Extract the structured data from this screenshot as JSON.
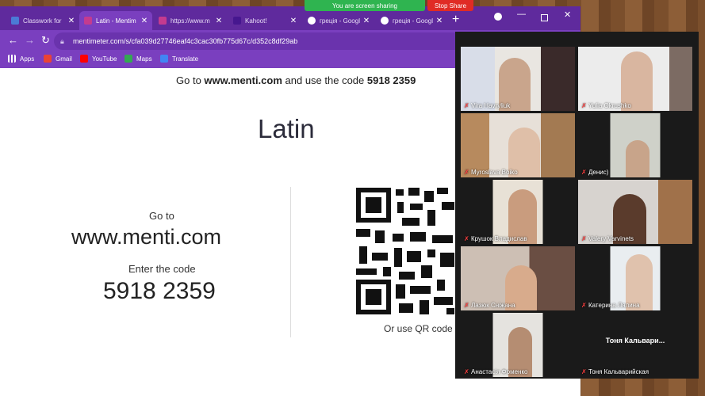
{
  "browser": {
    "tabs": [
      {
        "label": "Classwork for",
        "icon": "classroom-icon",
        "color": "#4b7bd6"
      },
      {
        "label": "Latin - Mentim",
        "icon": "mentimeter-icon",
        "color": "#c43b8f"
      },
      {
        "label": "https://www.m",
        "icon": "mentimeter-icon",
        "color": "#c43b8f"
      },
      {
        "label": "Kahoot!",
        "icon": "kahoot-icon",
        "color": "#46178f"
      },
      {
        "label": "греція - Googl",
        "icon": "google-icon",
        "color": "#ffffff"
      },
      {
        "label": "греція - Googl",
        "icon": "google-icon",
        "color": "#ffffff"
      }
    ],
    "new_tab": "+",
    "url": "mentimeter.com/s/cfa039d27746eaf4c3cac30fb775d67c/d352c8df29ab",
    "bookmarks": [
      {
        "label": "Apps",
        "icon": "apps-icon"
      },
      {
        "label": "Gmail",
        "icon": "gmail-icon"
      },
      {
        "label": "YouTube",
        "icon": "youtube-icon"
      },
      {
        "label": "Maps",
        "icon": "maps-icon"
      },
      {
        "label": "Translate",
        "icon": "translate-icon"
      }
    ]
  },
  "share": {
    "status": "You are screen sharing",
    "stop": "Stop Share"
  },
  "slide": {
    "top_prefix": "Go to ",
    "top_url": "www.menti.com",
    "top_mid": " and use the code ",
    "top_code": "5918 2359",
    "title": "Latin",
    "goto": "Go to",
    "url": "www.menti.com",
    "enter": "Enter the code",
    "code": "5918 2359",
    "qr_text": "Or use QR code"
  },
  "participants": [
    {
      "name": "Vira Havryliuk",
      "muted": true
    },
    {
      "name": "Yulia Okrushko",
      "muted": true
    },
    {
      "name": "Myroslava Boiko",
      "muted": true
    },
    {
      "name": "Денис)",
      "muted": true
    },
    {
      "name": "Крушок Владислав",
      "muted": true
    },
    {
      "name": "Valery Varvinets",
      "muted": true
    },
    {
      "name": "Лазюк Сніжана",
      "muted": true
    },
    {
      "name": "Катерина Лялина",
      "muted": true
    },
    {
      "name": "Анастасія Фоменко",
      "muted": true
    },
    {
      "name": "Тоня Кальварийская",
      "muted": true,
      "video_off_label": "Тоня  Кальвари..."
    }
  ]
}
